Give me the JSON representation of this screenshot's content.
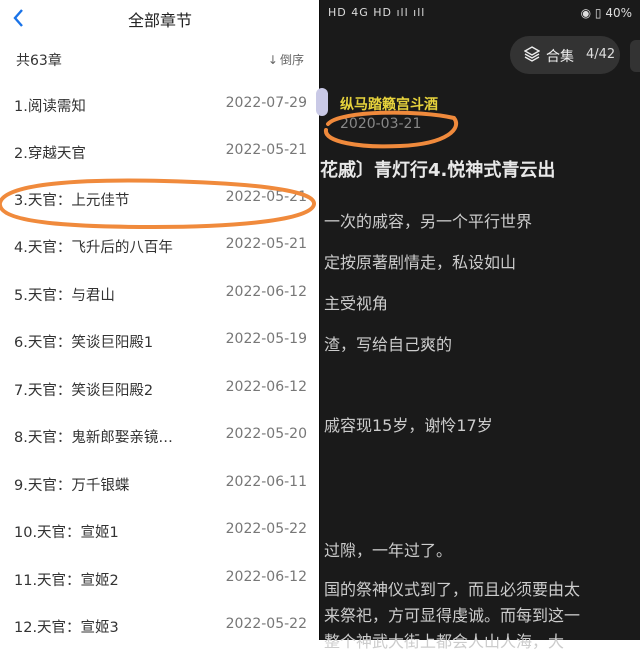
{
  "chapter_list": {
    "header": {
      "title": "全部章节",
      "back_icon": "chevron-left-icon"
    },
    "count_label": "共63章",
    "sort_label": "倒序",
    "sort_icon": "arrow-down-icon",
    "items": [
      {
        "title": "1.阅读需知",
        "date": "2022-07-29"
      },
      {
        "title": "2.穿越天官",
        "date": "2022-05-21"
      },
      {
        "title": "3.天官：上元佳节",
        "date": "2022-05-21"
      },
      {
        "title": "4.天官：飞升后的八百年",
        "date": "2022-05-21"
      },
      {
        "title": "5.天官：与君山",
        "date": "2022-06-12"
      },
      {
        "title": "6.天官：笑谈巨阳殿1",
        "date": "2022-05-19"
      },
      {
        "title": "7.天官：笑谈巨阳殿2",
        "date": "2022-06-12"
      },
      {
        "title": "8.天官：鬼新郎娶亲镜…",
        "date": "2022-05-20"
      },
      {
        "title": "9.天官：万千银蝶",
        "date": "2022-06-11"
      },
      {
        "title": "10.天官：宣姬1",
        "date": "2022-05-22"
      },
      {
        "title": "11.天官：宣姬2",
        "date": "2022-06-12"
      },
      {
        "title": "12.天官：宣姬3",
        "date": "2022-05-22"
      }
    ]
  },
  "reader": {
    "status": {
      "left": "HD 4G HD ıll ıll",
      "battery": "40%"
    },
    "collection": {
      "label": "合集",
      "page": "4/42",
      "icon": "layers-icon"
    },
    "author": "纵马踏籁宫斗酒",
    "date": "2020-03-21",
    "title": "花戚〕青灯行4.悦神式青云出",
    "lines": [
      "一次的戚容，另一个平行世界",
      "定按原著剧情走，私设如山",
      "主受视角",
      "渣，写给自己爽的",
      "戚容现15岁，谢怜17岁",
      "过隙，一年过了。",
      "国的祭神仪式到了，而且必须要由太",
      "来祭祀，方可显得虔诚。而每到这一",
      "整个神武大街上都会人山人海，大"
    ]
  },
  "colors": {
    "highlight": "#f08a3c",
    "accent": "#1a73e8",
    "reader_bg": "#1a1a1a"
  }
}
